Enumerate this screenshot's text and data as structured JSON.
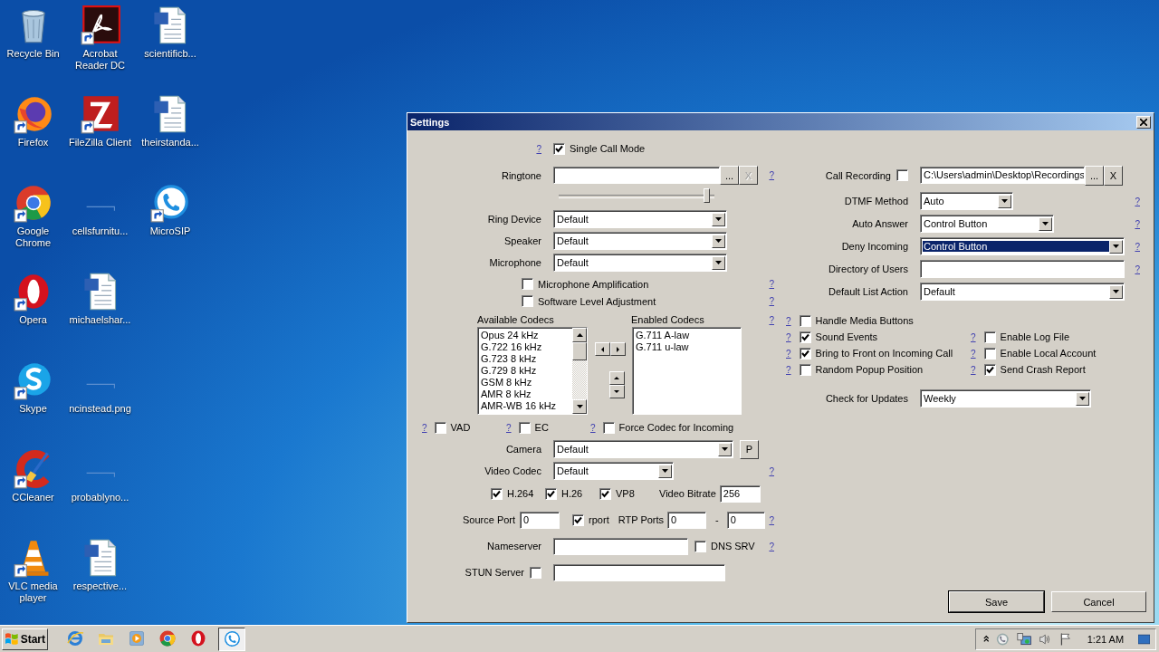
{
  "desktop": {
    "icons": [
      {
        "label": "Recycle Bin",
        "kind": "recycle",
        "shortcut": false
      },
      {
        "label": "Firefox",
        "kind": "firefox",
        "shortcut": true
      },
      {
        "label": "Google Chrome",
        "kind": "chrome",
        "shortcut": true
      },
      {
        "label": "Opera",
        "kind": "opera",
        "shortcut": true
      },
      {
        "label": "Skype",
        "kind": "skype",
        "shortcut": true
      },
      {
        "label": "CCleaner",
        "kind": "ccleaner",
        "shortcut": true
      },
      {
        "label": "VLC media player",
        "kind": "vlc",
        "shortcut": true
      },
      {
        "label": "Acrobat Reader DC",
        "kind": "acrobat",
        "shortcut": true
      },
      {
        "label": "FileZilla Client",
        "kind": "filezilla",
        "shortcut": true
      },
      {
        "label": "cellsfurnitu...",
        "kind": "blank",
        "shortcut": false
      },
      {
        "label": "michaelshar...",
        "kind": "word",
        "shortcut": false
      },
      {
        "label": "ncinstead.png",
        "kind": "blank",
        "shortcut": false
      },
      {
        "label": "probablyno...",
        "kind": "blank",
        "shortcut": false
      },
      {
        "label": "respective...",
        "kind": "word",
        "shortcut": false
      },
      {
        "label": "scientificb...",
        "kind": "word",
        "shortcut": false
      },
      {
        "label": "theirstanda...",
        "kind": "word",
        "shortcut": false
      },
      {
        "label": "MicroSIP",
        "kind": "microsip",
        "shortcut": true
      }
    ]
  },
  "dialog": {
    "title": "Settings",
    "single_call_mode": {
      "help": "?",
      "label": "Single Call Mode",
      "checked": true
    },
    "ringtone": {
      "label": "Ringtone",
      "browse": "...",
      "clear": "X",
      "clear_disabled": true,
      "help": "?",
      "volume": {
        "level": 0.97
      }
    },
    "devices": [
      {
        "label": "Ring Device",
        "value": "Default"
      },
      {
        "label": "Speaker",
        "value": "Default"
      },
      {
        "label": "Microphone",
        "value": "Default"
      }
    ],
    "audio_options": [
      {
        "label": "Microphone Amplification",
        "checked": false,
        "help": "?"
      },
      {
        "label": "Software Level Adjustment",
        "checked": false,
        "help": "?"
      }
    ],
    "codecs": {
      "available_label": "Available Codecs",
      "available": [
        "Opus 24 kHz",
        "G.722 16 kHz",
        "G.723 8 kHz",
        "G.729 8 kHz",
        "GSM 8 kHz",
        "AMR 8 kHz",
        "AMR-WB 16 kHz"
      ],
      "enabled_label": "Enabled Codecs",
      "enabled": [
        "G.711 A-law",
        "G.711 u-law"
      ],
      "help": "?"
    },
    "audio_flags": [
      {
        "help": "?",
        "label": "VAD",
        "checked": false
      },
      {
        "help": "?",
        "label": "EC",
        "checked": false
      },
      {
        "help": "?",
        "label": "Force Codec for Incoming",
        "checked": false
      }
    ],
    "camera": {
      "label": "Camera",
      "value": "Default",
      "button": "P"
    },
    "video_codec": {
      "label": "Video Codec",
      "value": "Default",
      "help": "?"
    },
    "video_formats": [
      {
        "label": "H.264",
        "checked": true
      },
      {
        "label": "H.26",
        "checked": true
      },
      {
        "label": "VP8",
        "checked": true
      }
    ],
    "video_bitrate": {
      "label": "Video Bitrate",
      "value": "256"
    },
    "source_port": {
      "label": "Source Port",
      "value": "0"
    },
    "rport": {
      "label": "rport",
      "checked": true
    },
    "rtp_ports": {
      "label": "RTP Ports",
      "from": "0",
      "separator": "-",
      "to": "0",
      "help": "?"
    },
    "nameserver": {
      "label": "Nameserver",
      "dns_srv": {
        "label": "DNS SRV",
        "checked": false
      },
      "help": "?"
    },
    "stun_server": {
      "label": "STUN Server",
      "checked": false
    },
    "call_recording": {
      "label": "Call Recording",
      "checked": false,
      "value": "C:\\Users\\admin\\Desktop\\Recordings",
      "browse": "...",
      "clear": "X",
      "clear_disabled": false
    },
    "fields": [
      {
        "kind": "select",
        "label": "DTMF Method",
        "value": "Auto",
        "help": "?",
        "highlighted": false
      },
      {
        "kind": "select",
        "label": "Auto Answer",
        "value": "Control Button",
        "help": "?",
        "highlighted": false
      },
      {
        "kind": "select",
        "label": "Deny Incoming",
        "value": "Control Button",
        "help": "?",
        "highlighted": true
      },
      {
        "kind": "text",
        "label": "Directory of Users",
        "help": "?"
      },
      {
        "kind": "select",
        "label": "Default List Action",
        "value": "Default",
        "highlighted": false
      }
    ],
    "flags_left": [
      {
        "help": "?",
        "label": "Handle Media Buttons",
        "checked": false
      },
      {
        "help": "?",
        "label": "Sound Events",
        "checked": true
      },
      {
        "help": "?",
        "label": "Bring to Front on Incoming Call",
        "checked": true
      },
      {
        "help": "?",
        "label": "Random Popup Position",
        "checked": false
      }
    ],
    "flags_right": [
      {
        "help": "?",
        "label": "Enable Log File",
        "checked": false
      },
      {
        "help": "?",
        "label": "Enable Local Account",
        "checked": false
      },
      {
        "help": "?",
        "label": "Send Crash Report",
        "checked": true
      }
    ],
    "check_for_updates": {
      "label": "Check for Updates",
      "value": "Weekly"
    },
    "buttons": [
      {
        "label": "Save",
        "default": true
      },
      {
        "label": "Cancel",
        "default": false
      }
    ]
  },
  "taskbar": {
    "start": "Start",
    "pinned": [
      {
        "kind": "ie",
        "active": false
      },
      {
        "kind": "folder",
        "active": false
      },
      {
        "kind": "media",
        "active": false
      },
      {
        "kind": "chrome",
        "active": false
      },
      {
        "kind": "opera",
        "active": false
      },
      {
        "kind": "microsip",
        "active": true
      }
    ],
    "clock": "1:21 AM"
  }
}
